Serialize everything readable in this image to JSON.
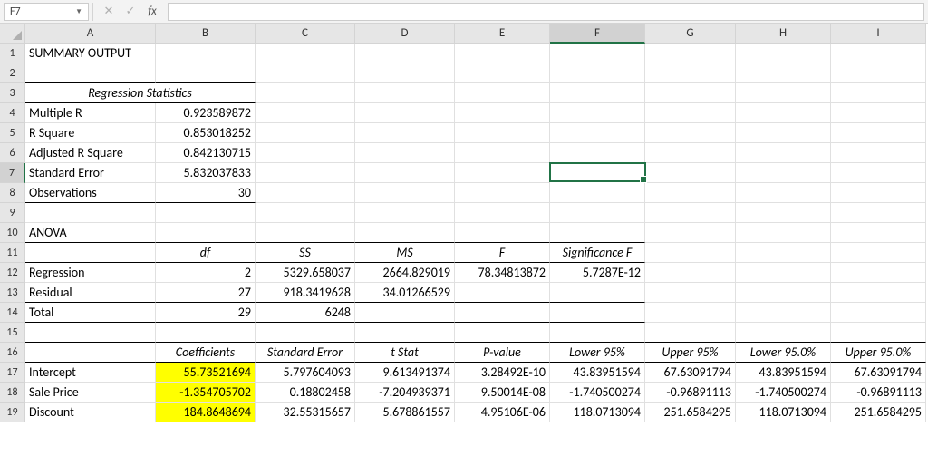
{
  "nameBox": "F7",
  "formulaBar": "",
  "columns": [
    "A",
    "B",
    "C",
    "D",
    "E",
    "F",
    "G",
    "H",
    "I"
  ],
  "selectedCol": "F",
  "selectedRow": 7,
  "rows": {
    "1": {
      "A": "SUMMARY OUTPUT"
    },
    "2": {},
    "3": {
      "A": "Regression Statistics"
    },
    "4": {
      "A": "Multiple R",
      "B": "0.923589872"
    },
    "5": {
      "A": "R Square",
      "B": "0.853018252"
    },
    "6": {
      "A": "Adjusted R Square",
      "B": "0.842130715"
    },
    "7": {
      "A": "Standard Error",
      "B": "5.832037833"
    },
    "8": {
      "A": "Observations",
      "B": "30"
    },
    "9": {},
    "10": {
      "A": "ANOVA"
    },
    "11": {
      "B": "df",
      "C": "SS",
      "D": "MS",
      "E": "F",
      "F": "Significance F"
    },
    "12": {
      "A": "Regression",
      "B": "2",
      "C": "5329.658037",
      "D": "2664.829019",
      "E": "78.34813872",
      "F": "5.7287E-12"
    },
    "13": {
      "A": "Residual",
      "B": "27",
      "C": "918.3419628",
      "D": "34.01266529"
    },
    "14": {
      "A": "Total",
      "B": "29",
      "C": "6248"
    },
    "15": {},
    "16": {
      "B": "Coefficients",
      "C": "Standard Error",
      "D": "t Stat",
      "E": "P-value",
      "F": "Lower 95%",
      "G": "Upper 95%",
      "H": "Lower 95.0%",
      "I": "Upper 95.0%"
    },
    "17": {
      "A": "Intercept",
      "B": "55.73521694",
      "C": "5.797604093",
      "D": "9.613491374",
      "E": "3.28492E-10",
      "F": "43.83951594",
      "G": "67.63091794",
      "H": "43.83951594",
      "I": "67.63091794"
    },
    "18": {
      "A": "Sale Price",
      "B": "-1.354705702",
      "C": "0.18802458",
      "D": "-7.204939371",
      "E": "9.50014E-08",
      "F": "-1.740500274",
      "G": "-0.96891113",
      "H": "-1.740500274",
      "I": "-0.96891113"
    },
    "19": {
      "A": "Discount",
      "B": "184.8648694",
      "C": "32.55315657",
      "D": "5.678861557",
      "E": "4.95106E-06",
      "F": "118.0713094",
      "G": "251.6584295",
      "H": "118.0713094",
      "I": "251.6584295"
    }
  }
}
